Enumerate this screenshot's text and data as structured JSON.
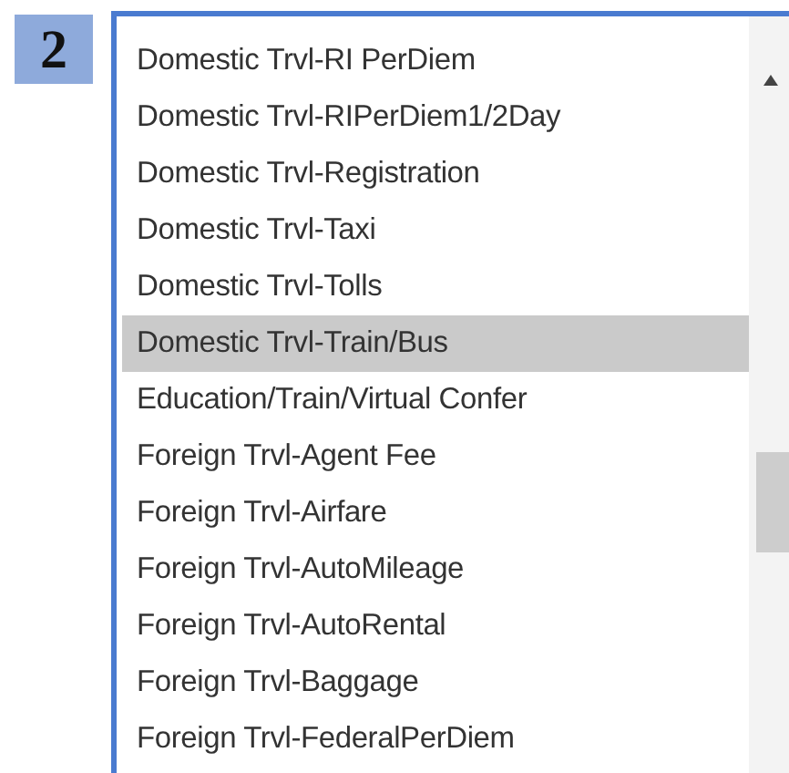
{
  "step_badge": "2",
  "list": {
    "items": [
      {
        "label": "Domestic Trvl-RI PerDiem",
        "selected": false
      },
      {
        "label": "Domestic Trvl-RIPerDiem1/2Day",
        "selected": false
      },
      {
        "label": "Domestic Trvl-Registration",
        "selected": false
      },
      {
        "label": "Domestic Trvl-Taxi",
        "selected": false
      },
      {
        "label": "Domestic Trvl-Tolls",
        "selected": false
      },
      {
        "label": "Domestic Trvl-Train/Bus",
        "selected": true
      },
      {
        "label": "Education/Train/Virtual Confer",
        "selected": false
      },
      {
        "label": "Foreign Trvl-Agent Fee",
        "selected": false
      },
      {
        "label": "Foreign Trvl-Airfare",
        "selected": false
      },
      {
        "label": "Foreign Trvl-AutoMileage",
        "selected": false
      },
      {
        "label": "Foreign Trvl-AutoRental",
        "selected": false
      },
      {
        "label": "Foreign Trvl-Baggage",
        "selected": false
      },
      {
        "label": "Foreign Trvl-FederalPerDiem",
        "selected": false
      }
    ]
  }
}
